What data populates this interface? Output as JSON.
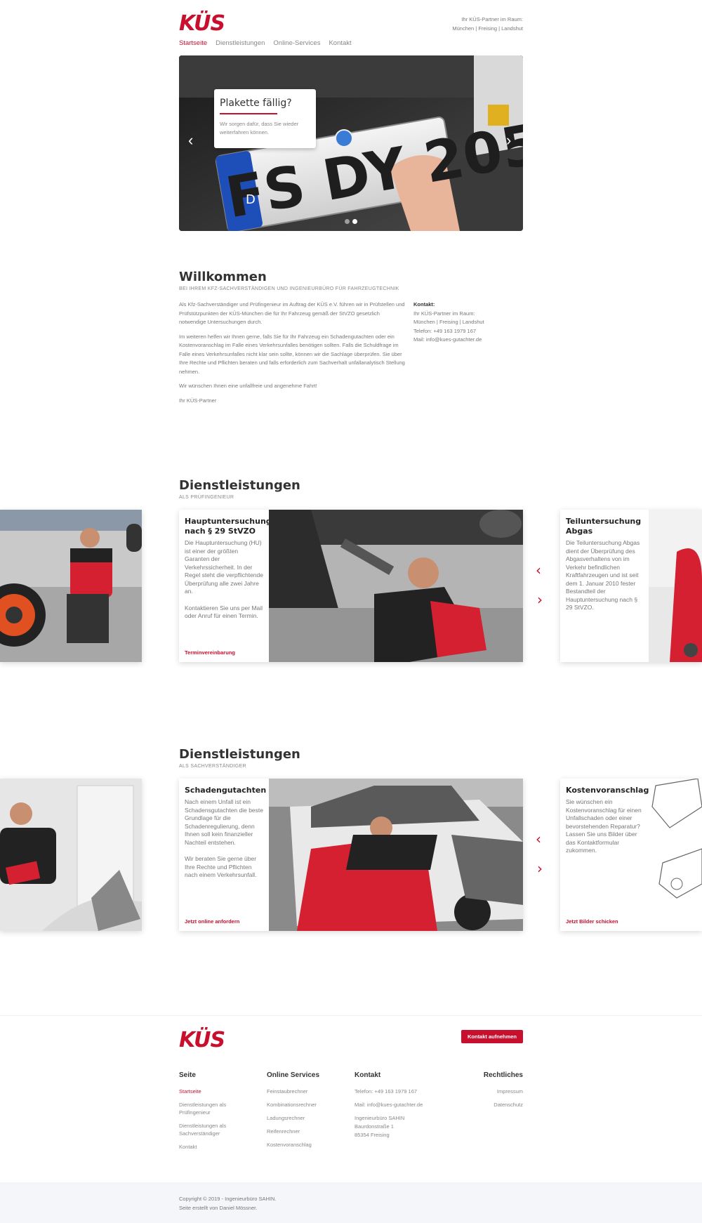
{
  "header": {
    "logo": "KÜS",
    "partner_line1": "Ihr KÜS-Partner im Raum:",
    "partner_line2": "München | Freising | Landshut",
    "nav": [
      "Startseite",
      "Dienstleistungen",
      "Online-Services",
      "Kontakt"
    ]
  },
  "hero": {
    "caption_title": "Plakette fällig?",
    "caption_text": "Wir sorgen dafür, dass Sie wieder weiterfahren können.",
    "plate_text": "FS DY 205",
    "plate_country": "D",
    "prev": "‹",
    "next": "›"
  },
  "welcome": {
    "title": "Willkommen",
    "kicker": "BEI IHREM KFZ-SACHVERSTÄNDIGEN UND INGENIEURBÜRO FÜR FAHRZEUGTECHNIK",
    "p1": "Als Kfz-Sachverständiger und Prüfingenieur im Auftrag der KÜS e.V. führen wir in Prüfstellen und Prüfstützpunkten der KÜS-München die für Ihr Fahrzeug gemäß der StVZO gesetzlich notwendige Untersuchungen durch.",
    "p2": "Im weiteren helfen wir Ihnen gerne, falls Sie für Ihr Fahrzeug ein Schadengutachten oder ein Kostenvoranschlag im Falle eines Verkehrsunfalles benötigen sollten. Falls die Schuldfrage im Falle eines Verkehrsunfalles nicht klar sein sollte, können wir die Sachlage überprüfen. Sie über Ihre Rechte und Pflichten beraten und falls erforderlich zum Sachverhalt unfallanalytisch Stellung nehmen.",
    "p3": "Wir wünschen Ihnen eine unfallfreie und angenehme Fahrt!",
    "p4": "Ihr KÜS-Partner",
    "contact_title": "Kontakt:",
    "contact_l1": "Ihr KÜS-Partner im Raum:",
    "contact_l2": "München | Freising | Landshut",
    "contact_l3": "Telefon: +49 163 1979 167",
    "contact_l4": "Mail: info@kues-gutachter.de"
  },
  "services_pruef": {
    "title": "Dienstleistungen",
    "kicker": "ALS PRÜFINGENIEUR",
    "main_title": "Hauptuntersuchung nach § 29 StVZO",
    "main_body": "Die Hauptuntersuchung (HU) ist einer der größten Garanten der Verkehrssicherheit. In der Regel steht die verpflichtende Überprüfung alle zwei Jahre an.",
    "main_body2": "Kontaktieren Sie uns per Mail oder Anruf für einen Termin.",
    "main_link": "Terminvereinbarung",
    "right_title": "Teiluntersuchung Abgas",
    "right_body": "Die Teiluntersuchung Abgas dient der Überprüfung des Abgasverhaltens von im Verkehr befindlichen Kraftfahrzeugen und ist seit dem 1. Januar 2010 fester Bestandteil der Hauptuntersuchung nach § 29 StVZO."
  },
  "services_sach": {
    "title": "Dienstleistungen",
    "kicker": "ALS SACHVERSTÄNDIGER",
    "main_title": "Schadengutachten",
    "main_body": "Nach einem Unfall ist ein Schadensgutachten die beste Grundlage für die Schadenregulierung, denn Ihnen soll kein finanzieller Nachteil entstehen.",
    "main_body2": "Wir beraten Sie gerne über Ihre Rechte und Pflichten nach einem Verkehrsunfall.",
    "main_link": "Jetzt online anfordern",
    "right_title": "Kostenvoranschlag",
    "right_body": "Sie wünschen ein Kostenvoranschlag für einen Unfallschaden oder einer bevorstehenden Reparatur? Lassen Sie uns Bilder über das Kontaktformular zukommen.",
    "right_link": "Jetzt Bilder schicken"
  },
  "footer": {
    "logo": "KÜS",
    "cta": "Kontakt aufnehmen",
    "col1_title": "Seite",
    "col1_links": [
      "Startseite",
      "Dienstleistungen als Prüfingenieur",
      "Dienstleistungen als Sachverständiger",
      "Kontakt"
    ],
    "col2_title": "Online Services",
    "col2_links": [
      "Feinstaubrechner",
      "Kombinationsrechner",
      "Ladungsrechner",
      "Reifenrechner",
      "Kostenvoranschlag"
    ],
    "col3_title": "Kontakt",
    "col3_items": [
      "Telefon: +49 163 1979 167",
      "Mail: info@kues-gutachter.de",
      "Ingenieurbüro SAHIN",
      "Baurdonstraße 1",
      "85354 Freising"
    ],
    "col4_title": "Rechtliches",
    "col4_links": [
      "Impressum",
      "Datenschutz"
    ],
    "copyright": "Copyright © 2019 - Ingenieurbüro SAHIN.",
    "credit": "Seite erstellt von Daniel Mössner."
  },
  "colors": {
    "brand": "#c8102e",
    "text": "#666666",
    "heading": "#333333"
  }
}
